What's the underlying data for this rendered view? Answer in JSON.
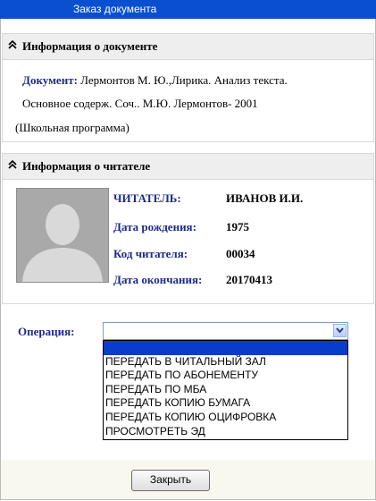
{
  "window": {
    "title": "Заказ документа"
  },
  "doc_section": {
    "header": "Информация о документе",
    "doc_label": "Документ:",
    "line1_text": "Лермонтов М. Ю.,Лирика. Анализ текста.",
    "line2_text": "Основное содерж. Соч.. М.Ю. Лермонтов-  2001",
    "line3_text": "(Школьная программа)"
  },
  "reader_section": {
    "header": "Информация о читателе",
    "reader_label": "ЧИТАТЕЛЬ:",
    "reader_value": "ИВАНОВ И.И.",
    "birth_label": "Дата рождения:",
    "birth_value": "1975",
    "code_label": "Код читателя:",
    "code_value": "00034",
    "end_label": "Дата окончания:",
    "end_value": "20170413"
  },
  "operation": {
    "label": "Операция:",
    "selected": "",
    "options": [
      "",
      "ПЕРЕДАТЬ В ЧИТАЛЬНЫЙ ЗАЛ",
      "ПЕРЕДАТЬ ПО АБОНЕМЕНТУ",
      "ПЕРЕДАТЬ ПО МБА",
      "ПЕРЕДАТЬ КОПИЮ БУМАГА",
      "ПЕРЕДАТЬ КОПИЮ ОЦИФРОВКА",
      "ПРОСМОТРЕТЬ ЭД"
    ]
  },
  "footer": {
    "close_label": "Закрыть"
  },
  "icons": {
    "collapse": "double-chevron-up-icon",
    "avatar": "user-silhouette-icon",
    "dropdown": "chevron-down-icon"
  },
  "colors": {
    "titlebar": "#0a4fd0",
    "label": "#1f2a8a",
    "highlight": "#0a3ccc"
  }
}
